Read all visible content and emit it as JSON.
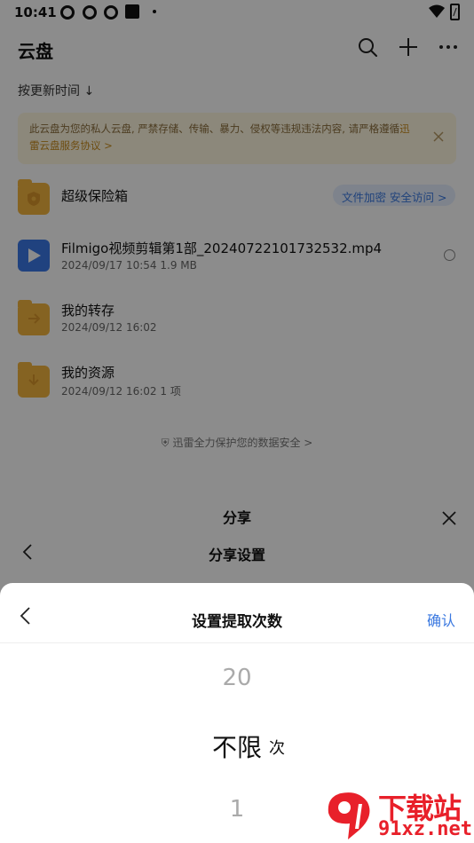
{
  "status_bar": {
    "time": "10:41"
  },
  "header": {
    "title": "云盘",
    "icons": [
      "search-icon",
      "plus-icon",
      "more-icon"
    ]
  },
  "sort": {
    "label": "按更新时间 ↓"
  },
  "notice": {
    "text": "此云盘为您的私人云盘, 严禁存储、传输、暴力、侵权等违规违法内容, 请严格遵循",
    "link": "迅雷云盘服务协议 >"
  },
  "files": [
    {
      "name": "超级保险箱",
      "meta": "",
      "icon": "vault-folder-icon",
      "badge": "文件加密 安全访问 >"
    },
    {
      "name": "Filmigo视频剪辑第1部_20240722101732532.mp4",
      "meta": "2024/09/17 10:54  1.9 MB",
      "icon": "video-file-icon"
    },
    {
      "name": "我的转存",
      "meta": "2024/09/12 16:02",
      "icon": "transfer-folder-icon"
    },
    {
      "name": "我的资源",
      "meta": "2024/09/12 16:02  1 项",
      "icon": "download-folder-icon"
    }
  ],
  "security_note": "迅雷全力保护您的数据安全 >",
  "share": {
    "title": "分享",
    "settings_title": "分享设置"
  },
  "sheet": {
    "title": "设置提取次数",
    "confirm": "确认",
    "picker": {
      "above": "20",
      "selected": "不限",
      "unit": "次",
      "below": "1"
    }
  },
  "watermark": {
    "top": "下载站",
    "bottom": "91xz.net"
  },
  "colors": {
    "accent": "#3a78e0",
    "folder": "#f3b43e",
    "video": "#3b78e7",
    "watermark": "#e8202a"
  }
}
